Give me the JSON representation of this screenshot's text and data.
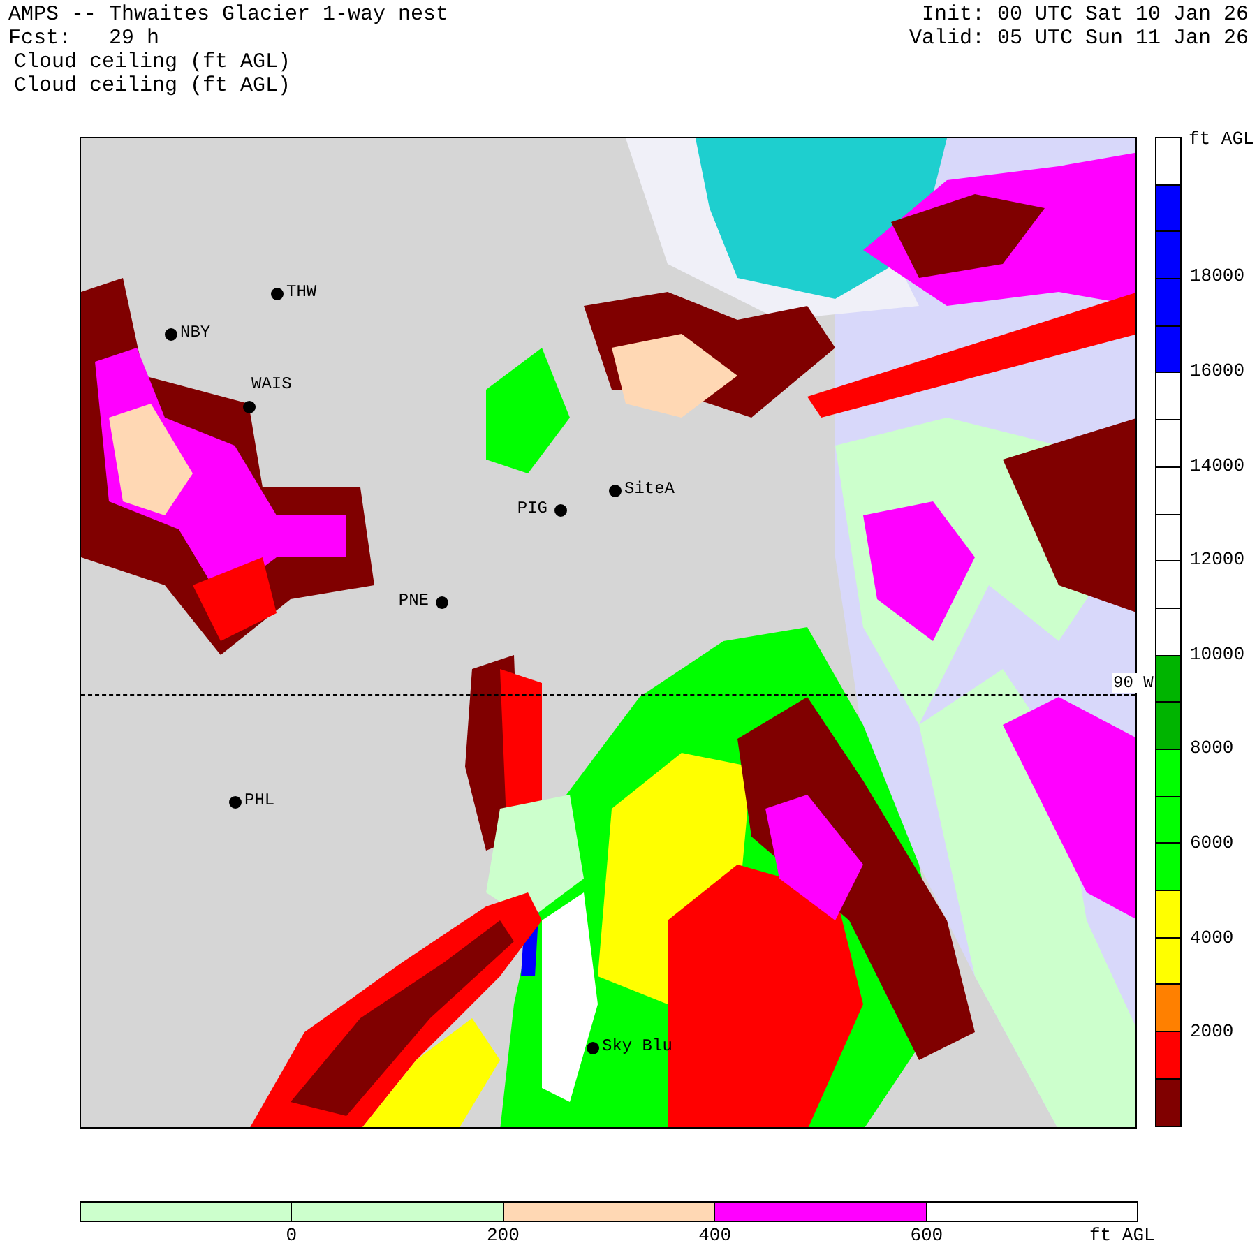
{
  "header": {
    "title": "AMPS -- Thwaites Glacier 1-way nest",
    "forecast": "Fcst:   29 h",
    "fields": [
      "Cloud ceiling (ft AGL)",
      "Cloud ceiling (ft AGL)"
    ],
    "init": "Init: 00 UTC Sat 10 Jan 26",
    "valid": "Valid: 05 UTC Sun 11 Jan 26"
  },
  "map": {
    "meridian_label": "90 W",
    "stations": [
      {
        "label": "THW"
      },
      {
        "label": "NBY"
      },
      {
        "label": "WAIS"
      },
      {
        "label": "PIG"
      },
      {
        "label": "SiteA"
      },
      {
        "label": "PNE"
      },
      {
        "label": "PHL"
      },
      {
        "label": "Sky Blu"
      }
    ]
  },
  "colorbar": {
    "units": "ft AGL",
    "labels": [
      "18000",
      "16000",
      "14000",
      "12000",
      "10000",
      "8000",
      "6000",
      "4000",
      "2000"
    ],
    "segments": [
      {
        "color": "#ffffff"
      },
      {
        "color": "#0000ff"
      },
      {
        "color": "#0000ff"
      },
      {
        "color": "#0000ff"
      },
      {
        "color": "#0000ff"
      },
      {
        "color": "#ffffff"
      },
      {
        "color": "#ffffff"
      },
      {
        "color": "#ffffff"
      },
      {
        "color": "#ffffff"
      },
      {
        "color": "#ffffff"
      },
      {
        "color": "#ffffff"
      },
      {
        "color": "#00b400"
      },
      {
        "color": "#00b400"
      },
      {
        "color": "#00ff00"
      },
      {
        "color": "#00ff00"
      },
      {
        "color": "#00ff00"
      },
      {
        "color": "#ffff00"
      },
      {
        "color": "#ffff00"
      },
      {
        "color": "#ff8000"
      },
      {
        "color": "#ff0000"
      },
      {
        "color": "#800000"
      }
    ]
  },
  "lower_colorbar": {
    "units": "ft AGL",
    "labels": [
      "0",
      "200",
      "400",
      "600"
    ],
    "segments": [
      {
        "color": "#ccffcc"
      },
      {
        "color": "#ccffcc"
      },
      {
        "color": "#ffd8b4"
      },
      {
        "color": "#ff00ff"
      },
      {
        "color": "#ffffff"
      }
    ]
  }
}
